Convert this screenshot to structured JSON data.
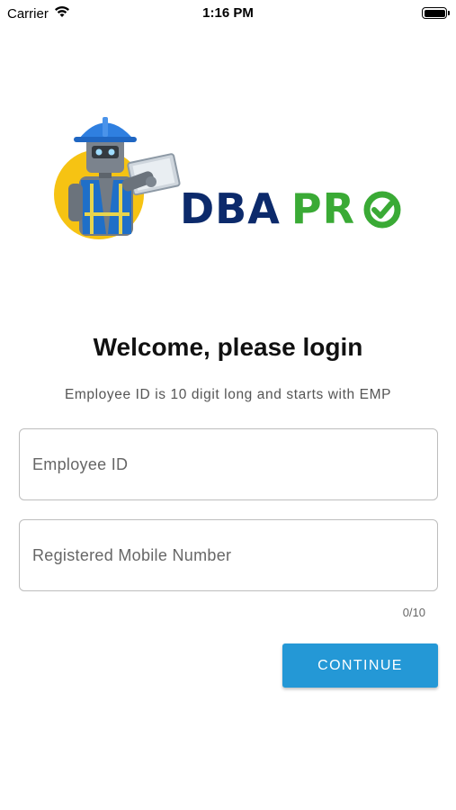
{
  "status_bar": {
    "carrier": "Carrier",
    "time": "1:16 PM",
    "wifi_icon": "wifi-icon",
    "battery_icon": "battery-icon"
  },
  "logo": {
    "brand_primary": "DBA",
    "brand_secondary": "PRO",
    "mascot": "robot-worker-with-tablet",
    "colors": {
      "primary": "#0c2a6b",
      "secondary": "#3aaa35",
      "badge": "#f6c313"
    }
  },
  "login": {
    "title": "Welcome, please login",
    "hint": "Employee ID is 10 digit long and starts with EMP",
    "employee_id_placeholder": "Employee ID",
    "employee_id_value": "",
    "mobile_placeholder": "Registered Mobile Number",
    "mobile_value": "",
    "char_counter": "0/10",
    "continue_label": "CONTINUE",
    "accent_color": "#2498d6"
  }
}
